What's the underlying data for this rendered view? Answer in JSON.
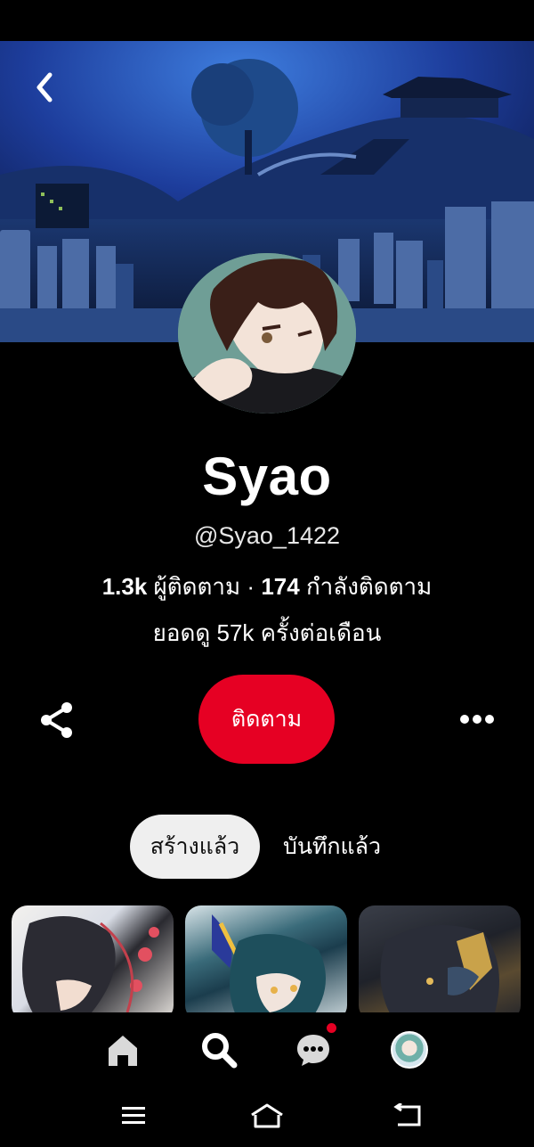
{
  "profile": {
    "name": "Syao",
    "handle": "@Syao_1422",
    "followers_count": "1.3k",
    "followers_label": "ผู้ติดตาม",
    "separator": "·",
    "following_count": "174",
    "following_label": "กำลังติดตาม",
    "monthly_views": "ยอดดู 57k ครั้งต่อเดือน"
  },
  "actions": {
    "follow_label": "ติดตาม"
  },
  "tabs": [
    {
      "label": "สร้างแล้ว",
      "active": true
    },
    {
      "label": "บันทึกแล้ว",
      "active": false
    }
  ],
  "icons": {
    "back": "chevron-left-icon",
    "share": "share-icon",
    "more": "more-horizontal-icon",
    "home": "home-icon",
    "search": "search-icon",
    "messages": "chat-bubble-icon",
    "profile": "avatar-icon",
    "sys_menu": "menu-icon",
    "sys_home": "home-outline-icon",
    "sys_back": "back-icon"
  },
  "colors": {
    "accent": "#e60023",
    "background": "#000000",
    "tab_active_bg": "#efefef",
    "nav_icon": "#d9d9d9"
  },
  "notifications": {
    "messages_unread": true
  }
}
